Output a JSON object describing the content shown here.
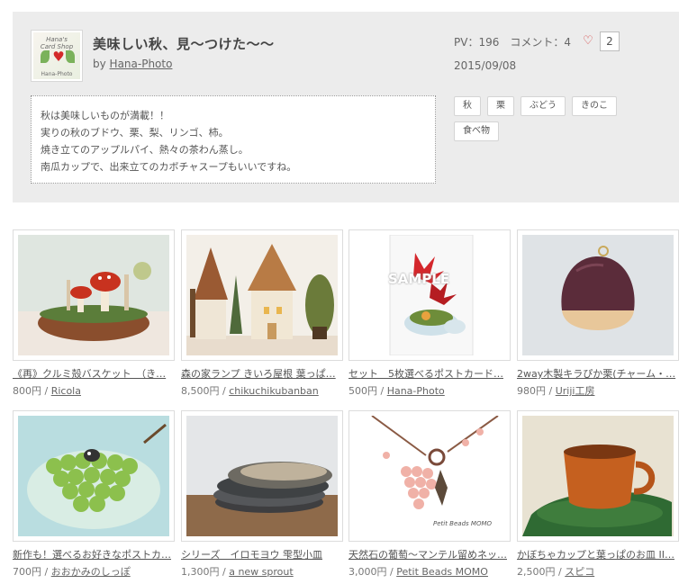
{
  "header": {
    "title": "美味しい秋、見〜つけた〜〜",
    "by_prefix": "by ",
    "author": "Hana-Photo",
    "avatar_logo_top": "Hana's",
    "avatar_logo_mid": "Card Shop",
    "avatar_logo_bottom": "Hana-Photo",
    "stats": {
      "pv": "PV：196",
      "comments": "コメント：4",
      "likes": "2"
    },
    "date": "2015/09/08"
  },
  "description": [
    "秋は美味しいものが満載！！",
    "実りの秋のブドウ、栗、梨、リンゴ、柿。",
    "焼き立てのアップルパイ、熱々の茶わん蒸し。",
    "南瓜カップで、出来立てのカボチャスープもいいですね。"
  ],
  "tags": [
    "秋",
    "栗",
    "ぶどう",
    "きのこ",
    "食べ物"
  ],
  "items": [
    {
      "title": "《再》クルミ殻バスケット　（き…",
      "price": "800円",
      "seller": "Ricola"
    },
    {
      "title": "森の家ランプ きいろ屋根 葉っぱ…",
      "price": "8,500円",
      "seller": "chikuchikubanban"
    },
    {
      "title": "セット　5枚選べるポストカード…",
      "price": "500円",
      "seller": "Hana-Photo",
      "image_label": "SAMPLE"
    },
    {
      "title": "2way木製キラぴか栗(チャーム・…",
      "price": "980円",
      "seller": "Uriji工房"
    },
    {
      "title": "新作も！選べるお好きなポストカ…",
      "price": "700円",
      "seller": "おおかみのしっぽ"
    },
    {
      "title": "シリーズ　イロモヨウ 雫型小皿",
      "price": "1,300円",
      "seller": "a new sprout"
    },
    {
      "title": "天然石の葡萄〜マンテル留めネッ…",
      "price": "3,000円",
      "seller": "Petit Beads MOMO",
      "image_label": "Petit Beads MOMO"
    },
    {
      "title": "かぼちゃカップと葉っぱのお皿 II…",
      "price": "2,500円",
      "seller": "スピコ"
    }
  ],
  "colors": {
    "panel_bg": "#ececec",
    "heart": "#d43b3b",
    "text": "#555555"
  },
  "icons": {
    "like": "heart-outline-icon"
  }
}
